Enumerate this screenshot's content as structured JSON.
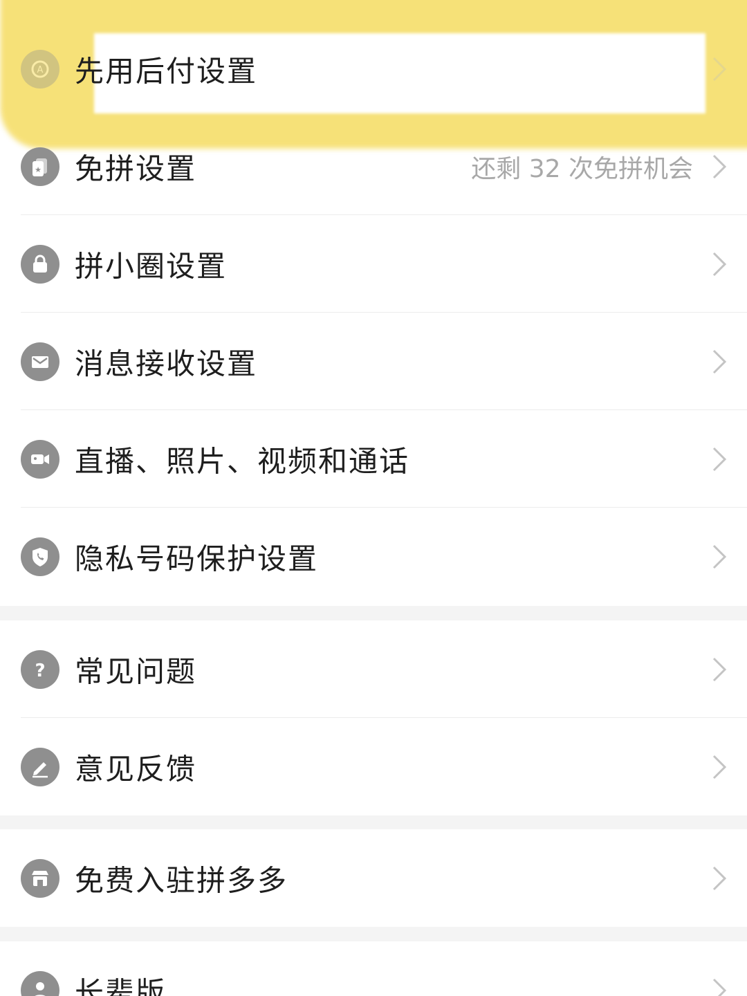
{
  "settings": {
    "items": [
      {
        "label": "先用后付设置",
        "icon": "pay-later-icon"
      },
      {
        "label": "免拼设置",
        "extra": "还剩 32 次免拼机会",
        "icon": "cards-icon"
      },
      {
        "label": "拼小圈设置",
        "icon": "lock-icon"
      },
      {
        "label": "消息接收设置",
        "icon": "mail-icon"
      },
      {
        "label": "直播、照片、视频和通话",
        "icon": "video-camera-icon"
      },
      {
        "label": "隐私号码保护设置",
        "icon": "shield-phone-icon"
      }
    ]
  },
  "help": {
    "items": [
      {
        "label": "常见问题",
        "icon": "question-icon"
      },
      {
        "label": "意见反馈",
        "icon": "pencil-icon"
      }
    ]
  },
  "merchant": {
    "items": [
      {
        "label": "免费入驻拼多多",
        "icon": "store-icon"
      }
    ]
  },
  "elder": {
    "items": [
      {
        "label": "长辈版",
        "icon": "elder-icon"
      }
    ]
  },
  "colors": {
    "highlight": "#f6de6a",
    "icon_bg": "#8f8f8f",
    "text": "#1e1e1e",
    "secondary_text": "#a8a8a8",
    "background": "#f4f4f4"
  }
}
